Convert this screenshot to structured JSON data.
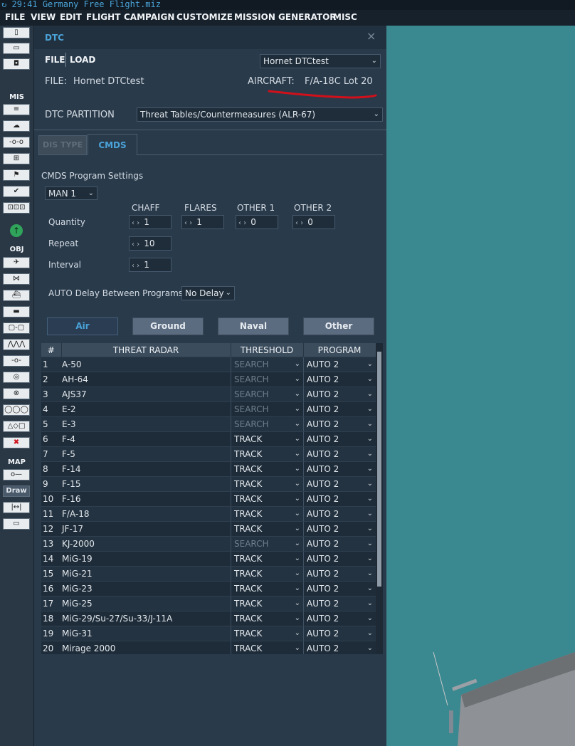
{
  "app": {
    "title": "29:41 Germany Free Flight.miz",
    "menu": [
      "FILE",
      "VIEW",
      "EDIT",
      "FLIGHT",
      "CAMPAIGN",
      "CUSTOMIZE",
      "MISSION GENERATOR",
      "MISC"
    ]
  },
  "toolbar": {
    "sections": {
      "mis": "MIS",
      "obj": "OBJ",
      "map": "MAP"
    },
    "draw_label": "Draw",
    "icons": [
      "new-file-icon",
      "open-file-icon",
      "save-file-icon",
      "briefing-icon",
      "weather-icon",
      "route-icon",
      "target-icon",
      "flags-icon",
      "check-icon",
      "formation-icon",
      "up-arrow-icon",
      "plane-icon",
      "helicopter-icon",
      "ship-icon",
      "vehicle-icon",
      "static-object-icon",
      "ruler-icon",
      "waypoint-icon",
      "trigger-zone-icon",
      "nav-point-icon",
      "group-icon",
      "shapes-icon",
      "delete-icon",
      "measure-icon",
      "draw-icon",
      "distance-icon",
      "map-options-icon"
    ]
  },
  "dtc": {
    "title": "DTC",
    "close_glyph": "×",
    "tabs": {
      "file": "FILE",
      "load": "LOAD"
    },
    "profile_select": "Hornet DTCtest",
    "file_label": "FILE:",
    "file_value": "Hornet DTCtest",
    "aircraft_label": "AIRCRAFT:",
    "aircraft_value": "F/A-18C Lot 20",
    "partition_label": "DTC PARTITION",
    "partition_value": "Threat Tables/Countermeasures (ALR-67)",
    "subtabs": [
      "DIS TYPE",
      "CMDS"
    ],
    "cmds": {
      "section_title": "CMDS Program Settings",
      "program_select": "MAN 1",
      "columns": [
        "CHAFF",
        "FLARES",
        "OTHER 1",
        "OTHER 2"
      ],
      "quantity_label": "Quantity",
      "quantity": [
        "1",
        "1",
        "0",
        "0"
      ],
      "repeat_label": "Repeat",
      "repeat": "10",
      "interval_label": "Interval",
      "interval": "1",
      "auto_delay_label": "AUTO Delay Between Programs",
      "auto_delay_value": "No Delay"
    },
    "categories": [
      "Air",
      "Ground",
      "Naval",
      "Other"
    ],
    "table": {
      "headers": [
        "#",
        "THREAT RADAR",
        "THRESHOLD",
        "PROGRAM"
      ],
      "rows": [
        {
          "n": "1",
          "radar": "A-50",
          "threshold": "SEARCH",
          "program": "AUTO 2"
        },
        {
          "n": "2",
          "radar": "AH-64",
          "threshold": "SEARCH",
          "program": "AUTO 2"
        },
        {
          "n": "3",
          "radar": "AJS37",
          "threshold": "SEARCH",
          "program": "AUTO 2"
        },
        {
          "n": "4",
          "radar": "E-2",
          "threshold": "SEARCH",
          "program": "AUTO 2"
        },
        {
          "n": "5",
          "radar": "E-3",
          "threshold": "SEARCH",
          "program": "AUTO 2"
        },
        {
          "n": "6",
          "radar": "F-4",
          "threshold": "TRACK",
          "program": "AUTO 2"
        },
        {
          "n": "7",
          "radar": "F-5",
          "threshold": "TRACK",
          "program": "AUTO 2"
        },
        {
          "n": "8",
          "radar": "F-14",
          "threshold": "TRACK",
          "program": "AUTO 2"
        },
        {
          "n": "9",
          "radar": "F-15",
          "threshold": "TRACK",
          "program": "AUTO 2"
        },
        {
          "n": "10",
          "radar": "F-16",
          "threshold": "TRACK",
          "program": "AUTO 2"
        },
        {
          "n": "11",
          "radar": "F/A-18",
          "threshold": "TRACK",
          "program": "AUTO 2"
        },
        {
          "n": "12",
          "radar": "JF-17",
          "threshold": "TRACK",
          "program": "AUTO 2"
        },
        {
          "n": "13",
          "radar": "KJ-2000",
          "threshold": "SEARCH",
          "program": "AUTO 2"
        },
        {
          "n": "14",
          "radar": "MiG-19",
          "threshold": "TRACK",
          "program": "AUTO 2"
        },
        {
          "n": "15",
          "radar": "MiG-21",
          "threshold": "TRACK",
          "program": "AUTO 2"
        },
        {
          "n": "16",
          "radar": "MiG-23",
          "threshold": "TRACK",
          "program": "AUTO 2"
        },
        {
          "n": "17",
          "radar": "MiG-25",
          "threshold": "TRACK",
          "program": "AUTO 2"
        },
        {
          "n": "18",
          "radar": "MiG-29/Su-27/Su-33/J-11A",
          "threshold": "TRACK",
          "program": "AUTO 2"
        },
        {
          "n": "19",
          "radar": "MiG-31",
          "threshold": "TRACK",
          "program": "AUTO 2"
        },
        {
          "n": "20",
          "radar": "Mirage 2000",
          "threshold": "TRACK",
          "program": "AUTO 2"
        }
      ]
    }
  },
  "colors": {
    "accent": "#4aa3d9",
    "panel": "#293a4b",
    "sea": "#3a8890",
    "annotation": "#d0101a"
  }
}
